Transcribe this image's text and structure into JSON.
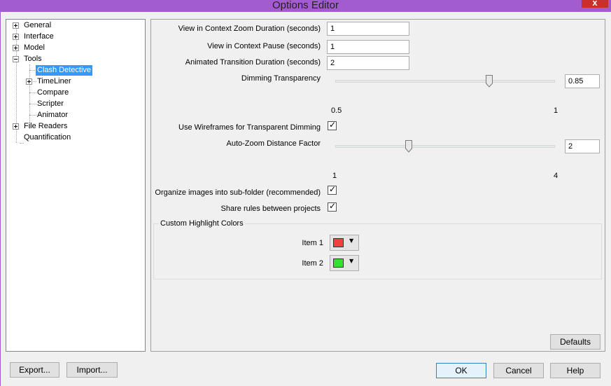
{
  "window": {
    "title": "Options Editor",
    "close_glyph": "x"
  },
  "tree": {
    "items": [
      {
        "label": "General",
        "expander": "plus"
      },
      {
        "label": "Interface",
        "expander": "plus"
      },
      {
        "label": "Model",
        "expander": "plus"
      },
      {
        "label": "Tools",
        "expander": "minus"
      },
      {
        "label": "Clash Detective",
        "selected": true
      },
      {
        "label": "TimeLiner",
        "expander": "plus"
      },
      {
        "label": "Compare"
      },
      {
        "label": "Scripter"
      },
      {
        "label": "Animator"
      },
      {
        "label": "File Readers",
        "expander": "plus"
      },
      {
        "label": "Quantification"
      }
    ]
  },
  "settings": {
    "zoom_duration": {
      "label": "View in Context Zoom Duration (seconds)",
      "value": "1"
    },
    "pause": {
      "label": "View in Context Pause (seconds)",
      "value": "1"
    },
    "transition": {
      "label": "Animated Transition Duration (seconds)",
      "value": "2"
    },
    "dimming": {
      "label": "Dimming Transparency",
      "value": "0.85",
      "min": "0.5",
      "max": "1",
      "level": 0.7
    },
    "wireframes": {
      "label": "Use Wireframes for Transparent Dimming",
      "checked": true
    },
    "autozoom": {
      "label": "Auto-Zoom Distance Factor",
      "value": "2",
      "min": "1",
      "max": "4",
      "level": 0.3333
    },
    "subfolder": {
      "label": "Organize images into sub-folder (recommended)",
      "checked": true
    },
    "share_rules": {
      "label": "Share rules between projects",
      "checked": true
    },
    "highlight": {
      "title": "Custom Highlight Colors",
      "items": [
        {
          "label": "Item 1",
          "color": "#f04040"
        },
        {
          "label": "Item 2",
          "color": "#33e033"
        }
      ]
    }
  },
  "buttons": {
    "defaults": "Defaults",
    "export": "Export...",
    "import": "Import...",
    "ok": "OK",
    "cancel": "Cancel",
    "help": "Help"
  },
  "icons": {
    "expand": "plus-box-icon",
    "collapse": "minus-box-icon",
    "dropdown": "chevron-down-icon",
    "checkmark": "checkmark-icon"
  }
}
